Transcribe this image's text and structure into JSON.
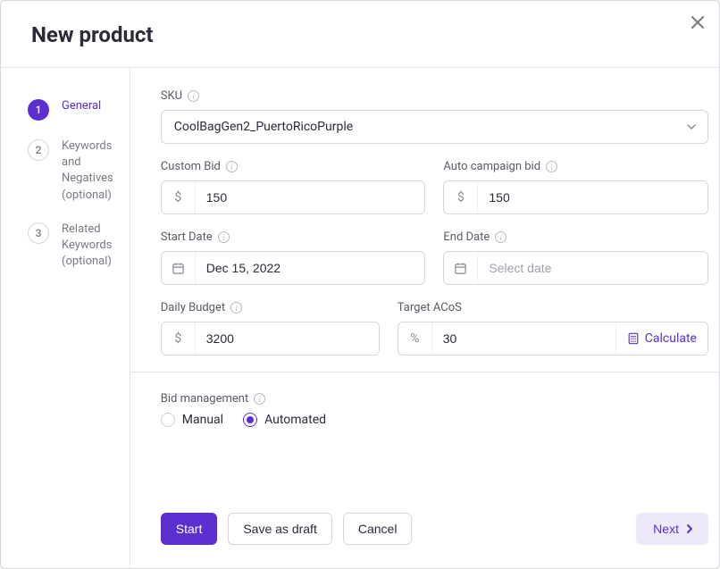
{
  "header": {
    "title": "New product"
  },
  "sidebar": {
    "steps": [
      {
        "num": "1",
        "label": "General",
        "active": true
      },
      {
        "num": "2",
        "label": "Keywords and Negatives (optional)",
        "active": false
      },
      {
        "num": "3",
        "label": "Related Keywords (optional)",
        "active": false
      }
    ]
  },
  "form": {
    "sku": {
      "label": "SKU",
      "value": "CoolBagGen2_PuertoRicoPurple"
    },
    "custom_bid": {
      "label": "Custom Bid",
      "prefix": "$",
      "value": "150"
    },
    "auto_bid": {
      "label": "Auto campaign bid",
      "prefix": "$",
      "value": "150"
    },
    "start_date": {
      "label": "Start Date",
      "value": "Dec 15, 2022"
    },
    "end_date": {
      "label": "End Date",
      "placeholder": "Select date",
      "value": ""
    },
    "daily_budget": {
      "label": "Daily Budget",
      "prefix": "$",
      "value": "3200"
    },
    "target_acos": {
      "label": "Target ACoS",
      "prefix": "%",
      "value": "30",
      "calc_label": "Calculate"
    },
    "bid_mgmt": {
      "label": "Bid management",
      "options": {
        "manual": "Manual",
        "automated": "Automated"
      },
      "selected": "automated"
    }
  },
  "footer": {
    "start": "Start",
    "save_draft": "Save as draft",
    "cancel": "Cancel",
    "next": "Next"
  }
}
